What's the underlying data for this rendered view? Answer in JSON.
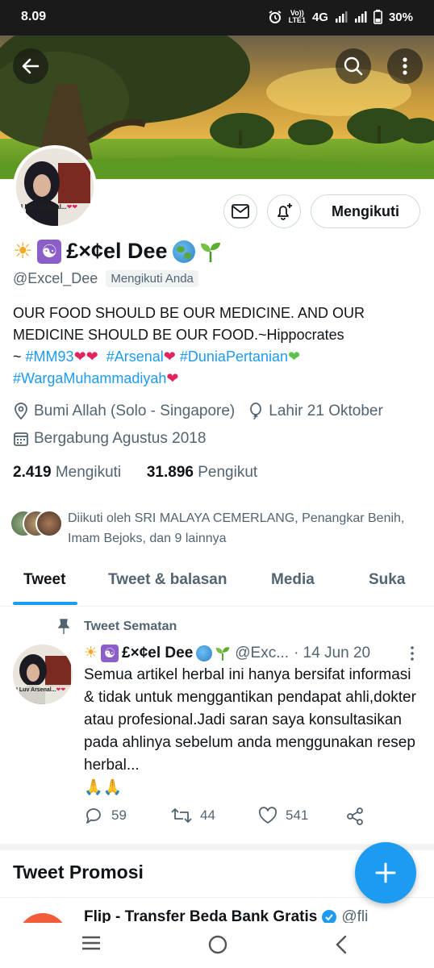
{
  "status_bar": {
    "time": "8.09",
    "volte": "Vo))",
    "lte": "LTE1",
    "network": "4G",
    "battery": "30%"
  },
  "profile": {
    "name": "£×¢el Dee",
    "handle": "@Excel_Dee",
    "follows_you": "Mengikuti Anda",
    "follow_button": "Mengikuti",
    "avatar_caption": "I Luv Arsenal...",
    "bio": {
      "line1": "OUR FOOD SHOULD BE OUR MEDICINE. AND OUR",
      "line2": "MEDICINE SHOULD BE OUR FOOD.~Hippocrates",
      "tilde": "~",
      "tag1": "#MM93",
      "tag2": "#Arsenal",
      "tag3": "#DuniaPertanian",
      "tag4": "#WargaMuhammadiyah"
    },
    "location": "Bumi Allah (Solo - Singapore)",
    "birthday": "Lahir 21 Oktober",
    "joined": "Bergabung Agustus 2018",
    "following_count": "2.419",
    "following_label": "Mengikuti",
    "followers_count": "31.896",
    "followers_label": "Pengikut",
    "followed_by": "Diikuti oleh SRI MALAYA CEMERLANG, Penangkar Benih, Imam Bejoks, dan 9 lainnya"
  },
  "tabs": [
    "Tweet",
    "Tweet & balasan",
    "Media",
    "Suka"
  ],
  "pinned": {
    "label": "Tweet Sematan",
    "author": "£×¢el Dee",
    "handle": "@Exc...",
    "date": "· 14 Jun 20",
    "text": "Semua artikel herbal ini hanya bersifat informasi & tidak untuk menggantikan pendapat ahli,dokter atau profesional.Jadi saran saya konsultasikan pada ahlinya sebelum anda menggunakan resep herbal...",
    "emoji": "🙏🙏",
    "replies": "59",
    "retweets": "44",
    "likes": "541"
  },
  "promoted": {
    "title": "Tweet Promosi",
    "author": "Flip - Transfer Beda Bank Gratis",
    "handle": "@fli"
  },
  "colors": {
    "accent": "#1d9bf0",
    "heart": "#e0245e",
    "green_heart": "#5dc14b",
    "muted": "#536471"
  },
  "icons": [
    "back-arrow-icon",
    "search-icon",
    "more-vertical-icon",
    "mail-icon",
    "bell-plus-icon",
    "location-icon",
    "balloon-icon",
    "calendar-icon",
    "pin-icon",
    "reply-icon",
    "retweet-icon",
    "like-icon",
    "share-icon",
    "plus-icon",
    "verified-icon"
  ]
}
